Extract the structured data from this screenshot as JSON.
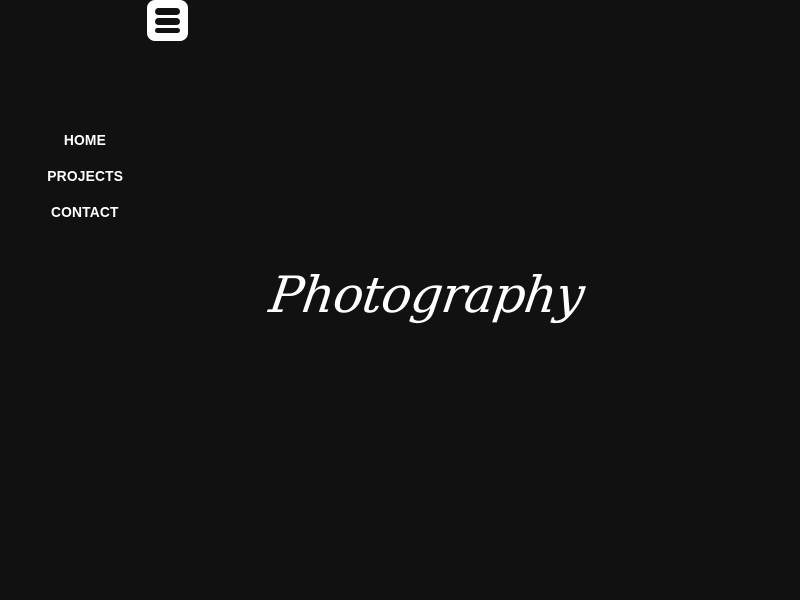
{
  "header": {
    "menu_toggle_icon": "menu-icon"
  },
  "nav": {
    "items": [
      {
        "label": "HOME"
      },
      {
        "label": "PROJECTS"
      },
      {
        "label": "CONTACT"
      }
    ]
  },
  "hero": {
    "title": "Photography"
  },
  "colors": {
    "background": "#111111",
    "text": "#ffffff"
  }
}
